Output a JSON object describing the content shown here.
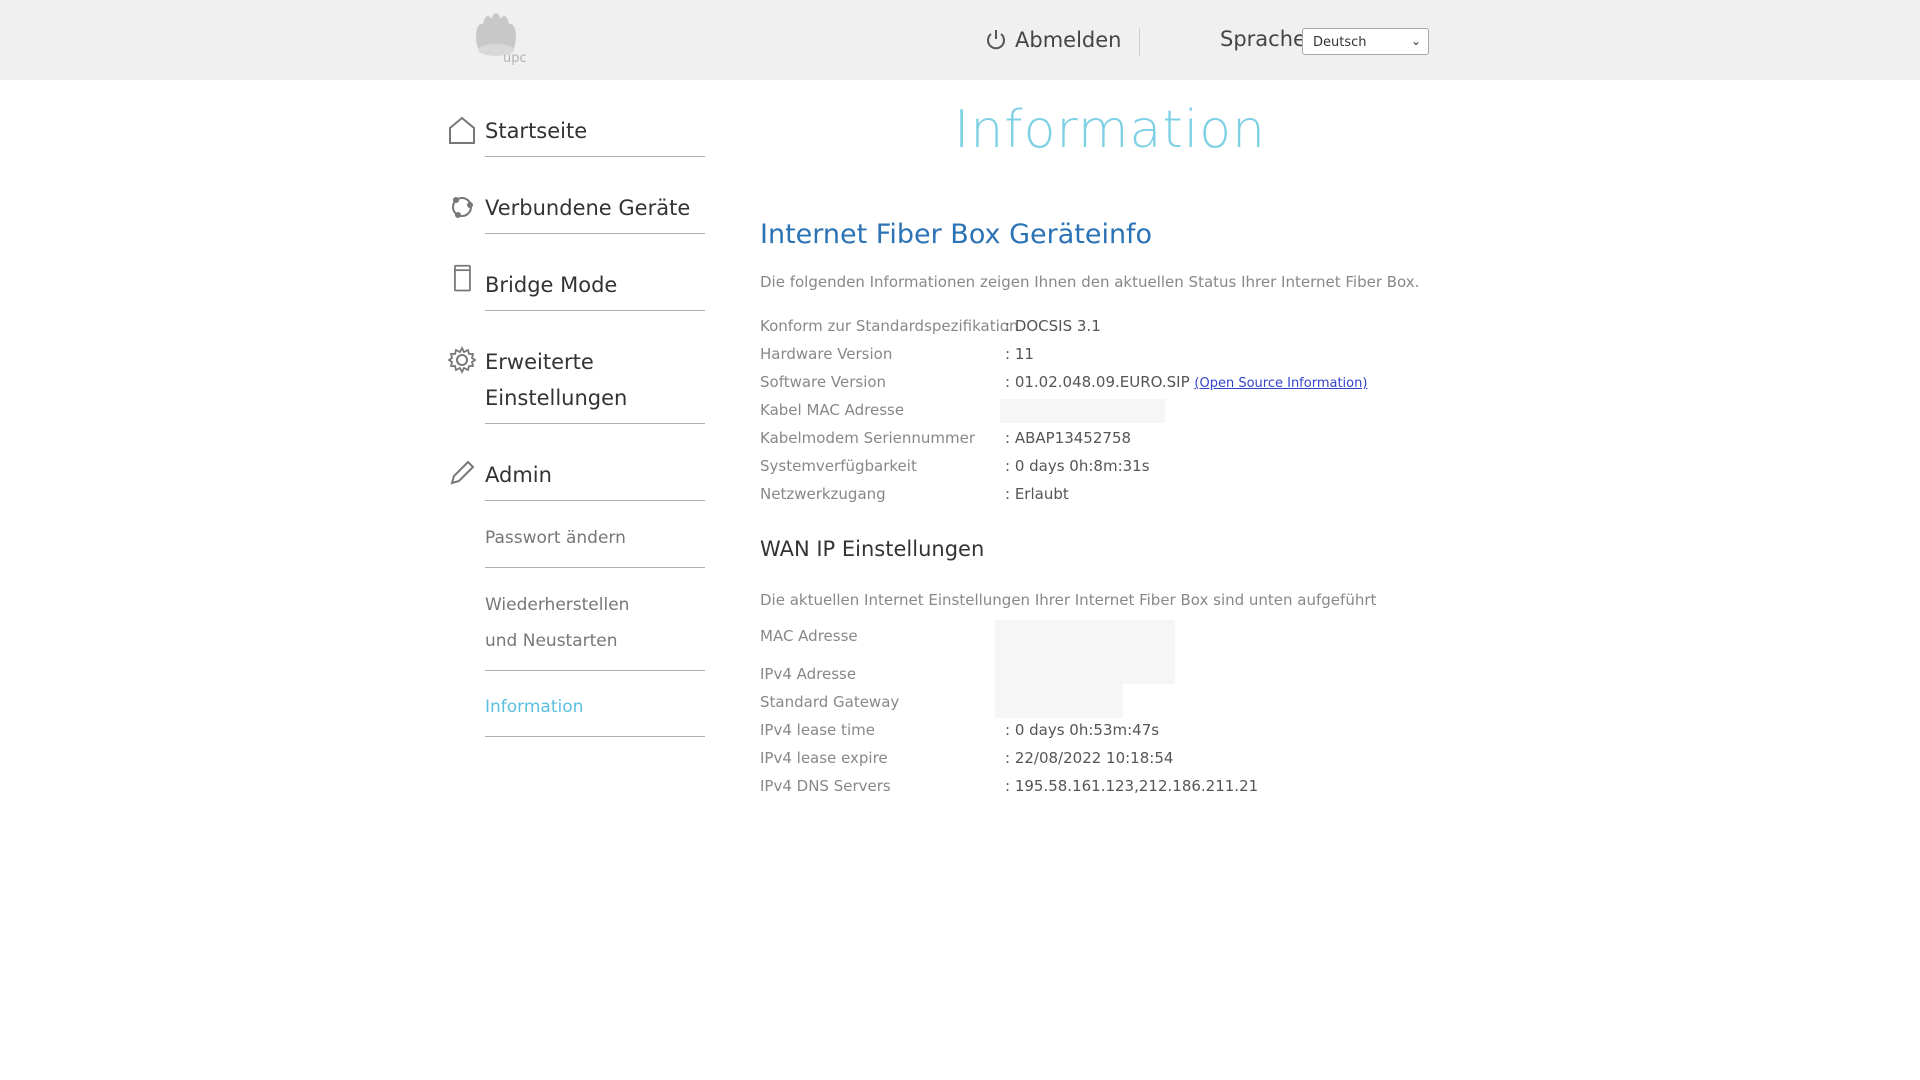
{
  "header": {
    "logo_text": "upc",
    "logout_label": "Abmelden",
    "language_label": "Sprache",
    "language_selected": "Deutsch"
  },
  "sidebar": {
    "items": [
      {
        "label": "Startseite",
        "icon": "home-icon"
      },
      {
        "label": "Verbundene Geräte",
        "icon": "devices-icon"
      },
      {
        "label": "Bridge Mode",
        "icon": "bridge-icon"
      },
      {
        "label": "Erweiterte Einstellungen",
        "icon": "gear-icon"
      },
      {
        "label": "Admin",
        "icon": "pencil-icon"
      }
    ],
    "sub_items": [
      {
        "label": "Passwort ändern"
      },
      {
        "label": "Wiederherstellen und Neustarten"
      },
      {
        "label": "Information",
        "active": true
      }
    ]
  },
  "main": {
    "page_title": "Information",
    "device_section": {
      "title": "Internet Fiber Box Geräteinfo",
      "description": "Die folgenden Informationen zeigen Ihnen den aktuellen Status Ihrer Internet Fiber Box.",
      "rows": [
        {
          "label": "Konform zur Standardspezifikation",
          "value": ": DOCSIS 3.1"
        },
        {
          "label": "Hardware Version",
          "value": ": 11"
        },
        {
          "label": "Software Version",
          "value": ": 01.02.048.09.EURO.SIP",
          "link": "(Open Source Information)"
        },
        {
          "label": "Kabel MAC Adresse",
          "value": ""
        },
        {
          "label": "Kabelmodem Seriennummer",
          "value": ": ABAP13452758"
        },
        {
          "label": "Systemverfügbarkeit",
          "value": ": 0 days 0h:8m:31s"
        },
        {
          "label": "Netzwerkzugang",
          "value": ": Erlaubt"
        }
      ]
    },
    "wan_section": {
      "title": "WAN IP Einstellungen",
      "description": "Die aktuellen Internet Einstellungen Ihrer Internet Fiber Box sind unten aufgeführt",
      "rows": [
        {
          "label": "MAC Adresse",
          "value": ""
        },
        {
          "label": "IPv4 Adresse",
          "value": ""
        },
        {
          "label": "Standard Gateway",
          "value": ""
        },
        {
          "label": "IPv4 lease time",
          "value": ": 0 days 0h:53m:47s"
        },
        {
          "label": "IPv4 lease expire",
          "value": ": 22/08/2022 10:18:54"
        },
        {
          "label": "IPv4 DNS Servers",
          "value": ": 195.58.161.123,212.186.211.21"
        }
      ]
    }
  },
  "colors": {
    "accent_cyan": "#5bc0de",
    "title_blue": "#2b73b5",
    "topbar_bg": "#f0f0f0"
  }
}
